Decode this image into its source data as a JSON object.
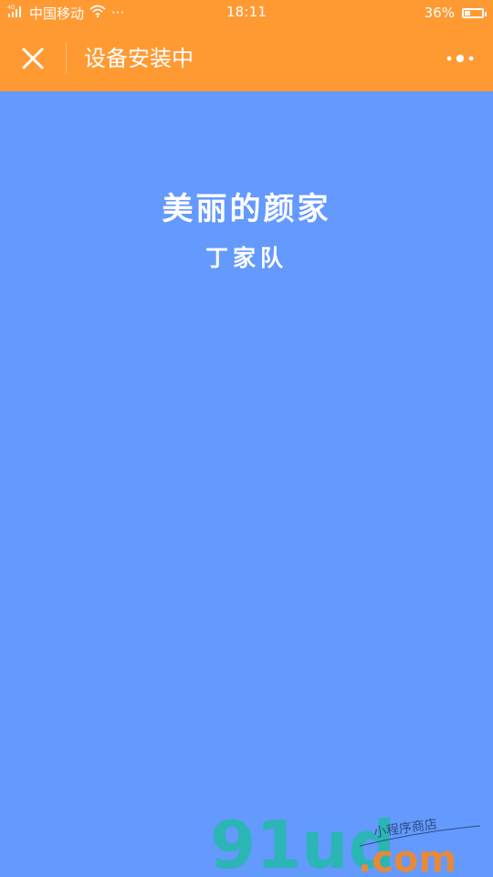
{
  "status_bar": {
    "carrier": "中国移动",
    "more": "···",
    "time": "18:11",
    "battery": "36%",
    "battery_level": 0.36
  },
  "nav": {
    "title": "设备安装中"
  },
  "content": {
    "title": "美丽的颜家",
    "subtitle": "丁家队"
  },
  "watermark": {
    "logo_text": "91ud.com 小程序商店"
  },
  "colors": {
    "header": "#FF9A33",
    "background": "#6499FE",
    "text": "#FFFFFF"
  }
}
